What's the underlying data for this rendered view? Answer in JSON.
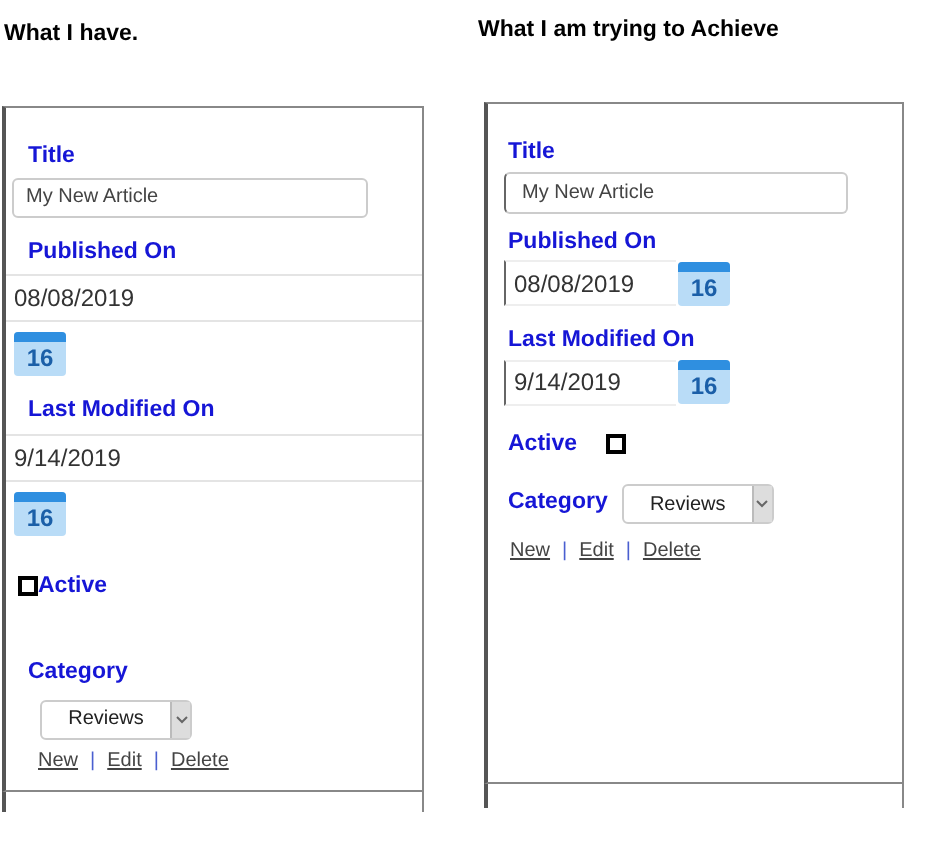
{
  "panels": [
    {
      "heading": "What I have.",
      "kind": "stacked",
      "title": {
        "label": "Title",
        "value": "My New Article"
      },
      "dates": [
        {
          "label": "Published On",
          "value": "08/08/2019",
          "calendar_day": "16"
        },
        {
          "label": "Last Modified On",
          "value": "9/14/2019",
          "calendar_day": "16"
        }
      ],
      "active": {
        "label": "Active",
        "checked": false
      },
      "category": {
        "label": "Category",
        "value": "Reviews"
      },
      "links": [
        "New",
        "Edit",
        "Delete"
      ],
      "separator": "|"
    },
    {
      "heading": "What I am trying to Achieve",
      "kind": "inline",
      "title": {
        "label": "Title",
        "value": "My New Article"
      },
      "dates": [
        {
          "label": "Published On",
          "value": "08/08/2019",
          "calendar_day": "16"
        },
        {
          "label": "Last Modified On",
          "value": "9/14/2019",
          "calendar_day": "16"
        }
      ],
      "active": {
        "label": "Active",
        "checked": false
      },
      "category": {
        "label": "Category",
        "value": "Reviews"
      },
      "links": [
        "New",
        "Edit",
        "Delete"
      ],
      "separator": "|"
    }
  ]
}
